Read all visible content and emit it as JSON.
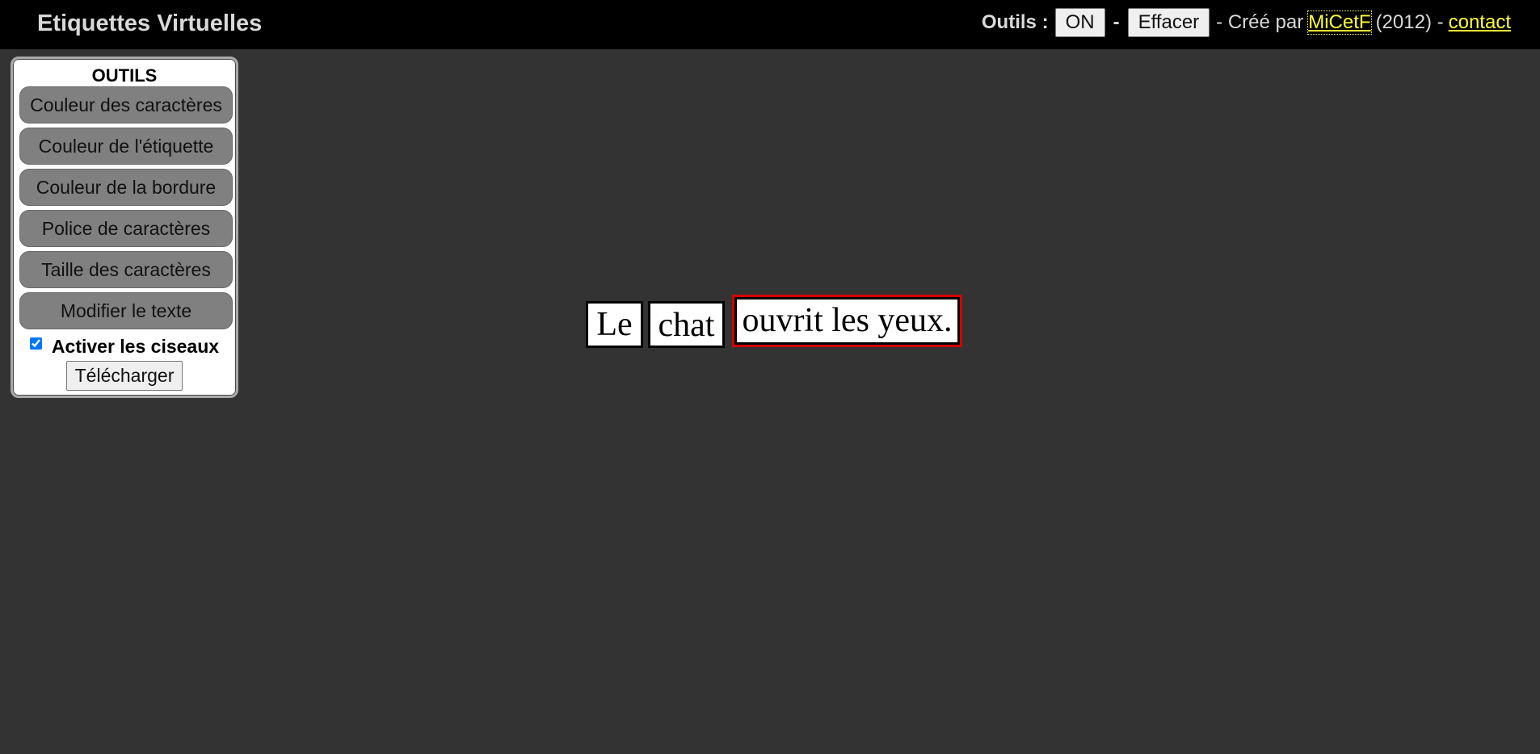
{
  "header": {
    "title": "Etiquettes Virtuelles",
    "tools_label": "Outils :",
    "toggle_label": "ON",
    "dash1": "-",
    "clear_label": "Effacer",
    "credit_prefix": "- Créé par",
    "author_link": "MiCetF",
    "year_text": "(2012) -",
    "contact_link": "contact"
  },
  "tools": {
    "title": "OUTILS",
    "buttons": [
      "Couleur des caractères",
      "Couleur de l'étiquette",
      "Couleur de la bordure",
      "Police de caractères",
      "Taille des caractères",
      "Modifier le texte"
    ],
    "scissors_label": "Activer les ciseaux",
    "scissors_checked": true,
    "download_label": "Télécharger"
  },
  "canvas": {
    "tags": [
      {
        "text": "Le",
        "selected": false
      },
      {
        "text": "chat",
        "selected": false
      },
      {
        "text": "ouvrit les yeux.",
        "selected": true
      }
    ],
    "selection_color": "#d40000"
  }
}
